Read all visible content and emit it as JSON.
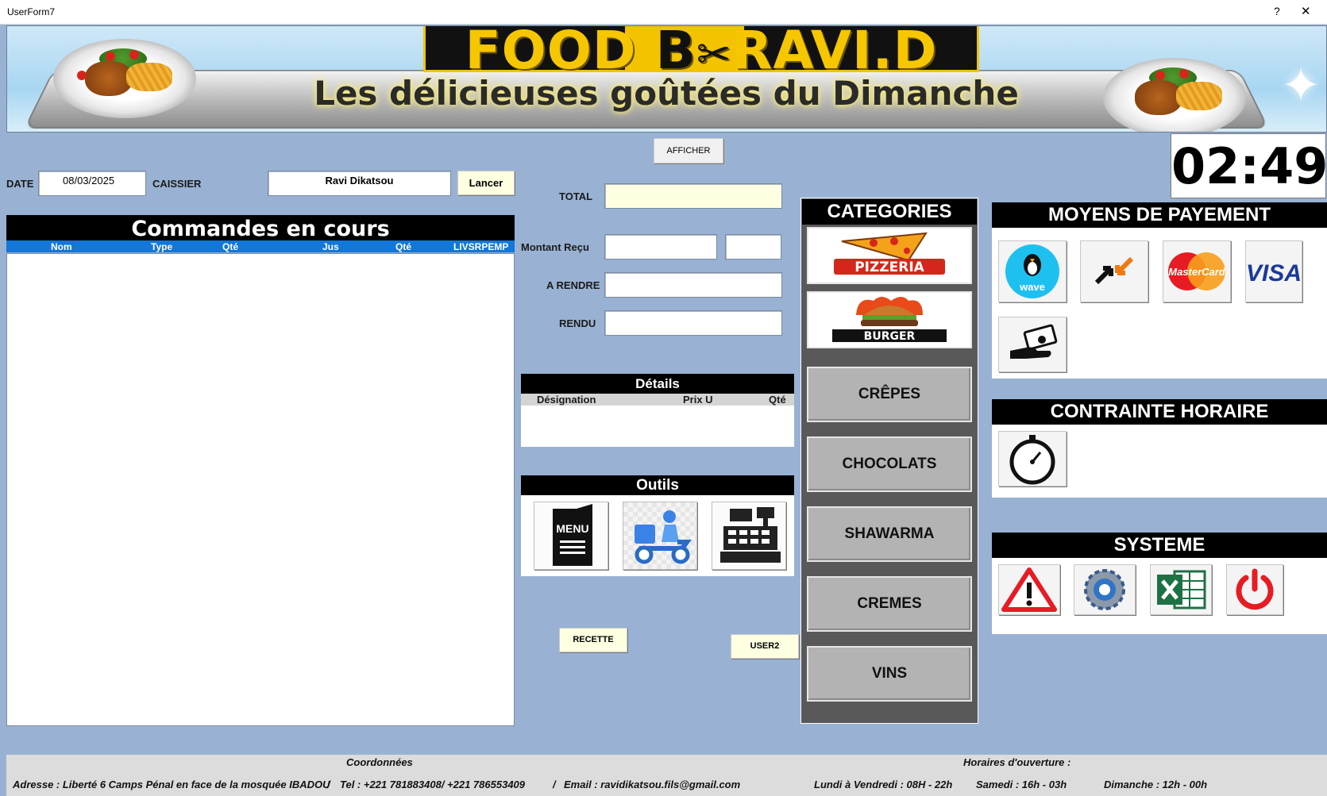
{
  "window": {
    "title": "UserForm7",
    "help": "?",
    "close": "✕"
  },
  "banner": {
    "brand_left": "FOOD ",
    "brand_mid": "B",
    "brand_right": "RAVI.D",
    "brand_utensils": "✂",
    "slogan": "Les délicieuses goûtées du Dimanche"
  },
  "header": {
    "afficher_label": "AFFICHER",
    "clock": "02:49",
    "date_label": "DATE",
    "date_value": "08/03/2025",
    "caissier_label": "CAISSIER",
    "caissier_value": "Ravi Dikatsou",
    "lancer_label": "Lancer"
  },
  "commandes": {
    "title": "Commandes en cours",
    "columns": [
      "Nom",
      "Type",
      "Qté",
      "Jus",
      "Qté",
      "LIVSRPEMP"
    ]
  },
  "caisse": {
    "total_label": "TOTAL",
    "montant_label": "Montant Reçu",
    "a_rendre_label": "A RENDRE",
    "rendu_label": "RENDU"
  },
  "details": {
    "title": "Détails",
    "columns": [
      "Désignation",
      "Prix U",
      "Qté"
    ]
  },
  "outils": {
    "title": "Outils",
    "menu_text": "MENU",
    "tools": [
      "menu-icon",
      "delivery-scooter-icon",
      "cash-register-icon"
    ]
  },
  "buttons": {
    "recette": "RECETTE",
    "user2": "USER2"
  },
  "categories": {
    "title": "CATEGORIES",
    "image_items": [
      {
        "name": "pizzeria",
        "text": "PIZZERIA"
      },
      {
        "name": "burger",
        "text": "BURGER"
      }
    ],
    "items": [
      "CRÊPES",
      "CHOCOLATS",
      "SHAWARMA",
      "CREMES",
      "VINS"
    ]
  },
  "payment": {
    "title": "MOYENS DE PAYEMENT",
    "wave_text": "wave",
    "mastercard_text": "MasterCard",
    "visa_text": "VISA",
    "icons": [
      "wave-icon",
      "orange-money-icon",
      "mastercard-icon",
      "visa-icon",
      "cash-hand-icon"
    ]
  },
  "contrainte": {
    "title": "CONTRAINTE HORAIRE",
    "icons": [
      "stopwatch-icon"
    ]
  },
  "systeme": {
    "title": "SYSTEME",
    "icons": [
      "warning-icon",
      "settings-gear-icon",
      "excel-icon",
      "power-icon"
    ]
  },
  "footer": {
    "coordonnees_label": "Coordonnées",
    "adresse": "Adresse : Liberté 6 Camps Pénal en face de la mosquée IBADOU",
    "tel": "Tel : +221 781883408/ +221 786553409",
    "email": "Email : ravidikatsou.fils@gmail.com",
    "sep": "/",
    "horaires_label": "Horaires d'ouverture :",
    "semaine": "Lundi à Vendredi : 08H - 22h",
    "samedi": "Samedi : 16h - 03h",
    "dimanche": "Dimanche : 12h - 00h"
  },
  "colors": {
    "form_bg": "#99b2d3",
    "header_black": "#000000",
    "list_header_blue": "#1277d8",
    "brand_yellow": "#f6c600",
    "total_field": "#ffffe1"
  }
}
